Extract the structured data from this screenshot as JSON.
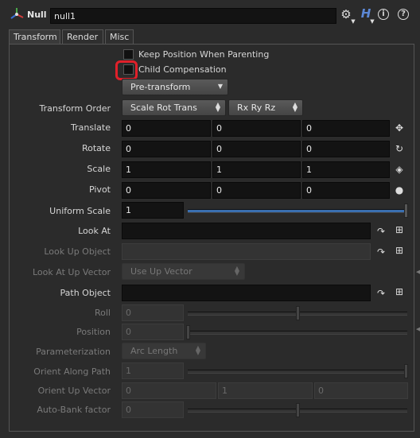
{
  "header": {
    "node_type": "Null",
    "node_name": "null1"
  },
  "tabs": [
    "Transform",
    "Render",
    "Misc"
  ],
  "params": {
    "keep_position": "Keep Position When Parenting",
    "child_comp": "Child Compensation",
    "pre_transform": "Pre-transform",
    "transform_order_label": "Transform Order",
    "transform_order_value": "Scale Rot Trans",
    "rotate_order_value": "Rx Ry Rz",
    "translate_label": "Translate",
    "translate": [
      "0",
      "0",
      "0"
    ],
    "rotate_label": "Rotate",
    "rotate": [
      "0",
      "0",
      "0"
    ],
    "scale_label": "Scale",
    "scale": [
      "1",
      "1",
      "1"
    ],
    "pivot_label": "Pivot",
    "pivot": [
      "0",
      "0",
      "0"
    ],
    "uniform_scale_label": "Uniform Scale",
    "uniform_scale": "1",
    "look_at_label": "Look At",
    "look_up_object_label": "Look Up Object",
    "look_at_up_vector_label": "Look At Up Vector",
    "look_at_up_vector_value": "Use Up Vector",
    "path_object_label": "Path Object",
    "roll_label": "Roll",
    "roll": "0",
    "position_label": "Position",
    "position": "0",
    "parameterization_label": "Parameterization",
    "parameterization_value": "Arc Length",
    "orient_along_path_label": "Orient Along Path",
    "orient_along_path": "1",
    "orient_up_vector_label": "Orient Up Vector",
    "orient_up_vector": [
      "0",
      "1",
      "0"
    ],
    "auto_bank_label": "Auto-Bank factor",
    "auto_bank": "0"
  },
  "colors": {
    "highlight": "#e0202a",
    "slider_fill": "#3a6fb0"
  }
}
